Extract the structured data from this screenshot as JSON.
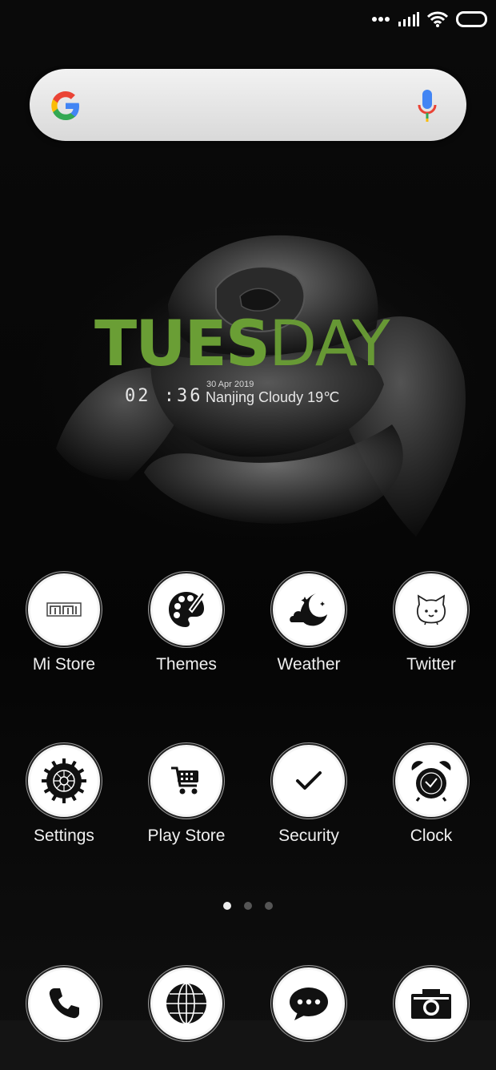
{
  "status_bar": {
    "icons": [
      "more-dots-icon",
      "signal-icon",
      "wifi-icon",
      "battery-icon"
    ]
  },
  "search": {
    "placeholder": "",
    "logo_icon": "google-g-icon",
    "mic_icon": "microphone-icon"
  },
  "widget": {
    "day_bold": "TUES",
    "day_light": "DAY",
    "time": "02 :36",
    "date": "30 Apr 2019",
    "weather": "Nanjing Cloudy 19℃",
    "accent_color": "#6a9e35"
  },
  "apps": [
    {
      "label": "Mi Store",
      "icon": "mi-store-icon"
    },
    {
      "label": "Themes",
      "icon": "palette-icon"
    },
    {
      "label": "Weather",
      "icon": "moon-cloud-icon"
    },
    {
      "label": "Twitter",
      "icon": "cat-face-icon"
    },
    {
      "label": "Settings",
      "icon": "gear-icon"
    },
    {
      "label": "Play Store",
      "icon": "shopping-cart-icon"
    },
    {
      "label": "Security",
      "icon": "check-icon"
    },
    {
      "label": "Clock",
      "icon": "alarm-clock-icon"
    }
  ],
  "page_indicator": {
    "pages": 3,
    "active": 1
  },
  "dock": [
    {
      "icon": "phone-icon"
    },
    {
      "icon": "globe-icon"
    },
    {
      "icon": "chat-bubble-icon"
    },
    {
      "icon": "camera-icon"
    }
  ]
}
